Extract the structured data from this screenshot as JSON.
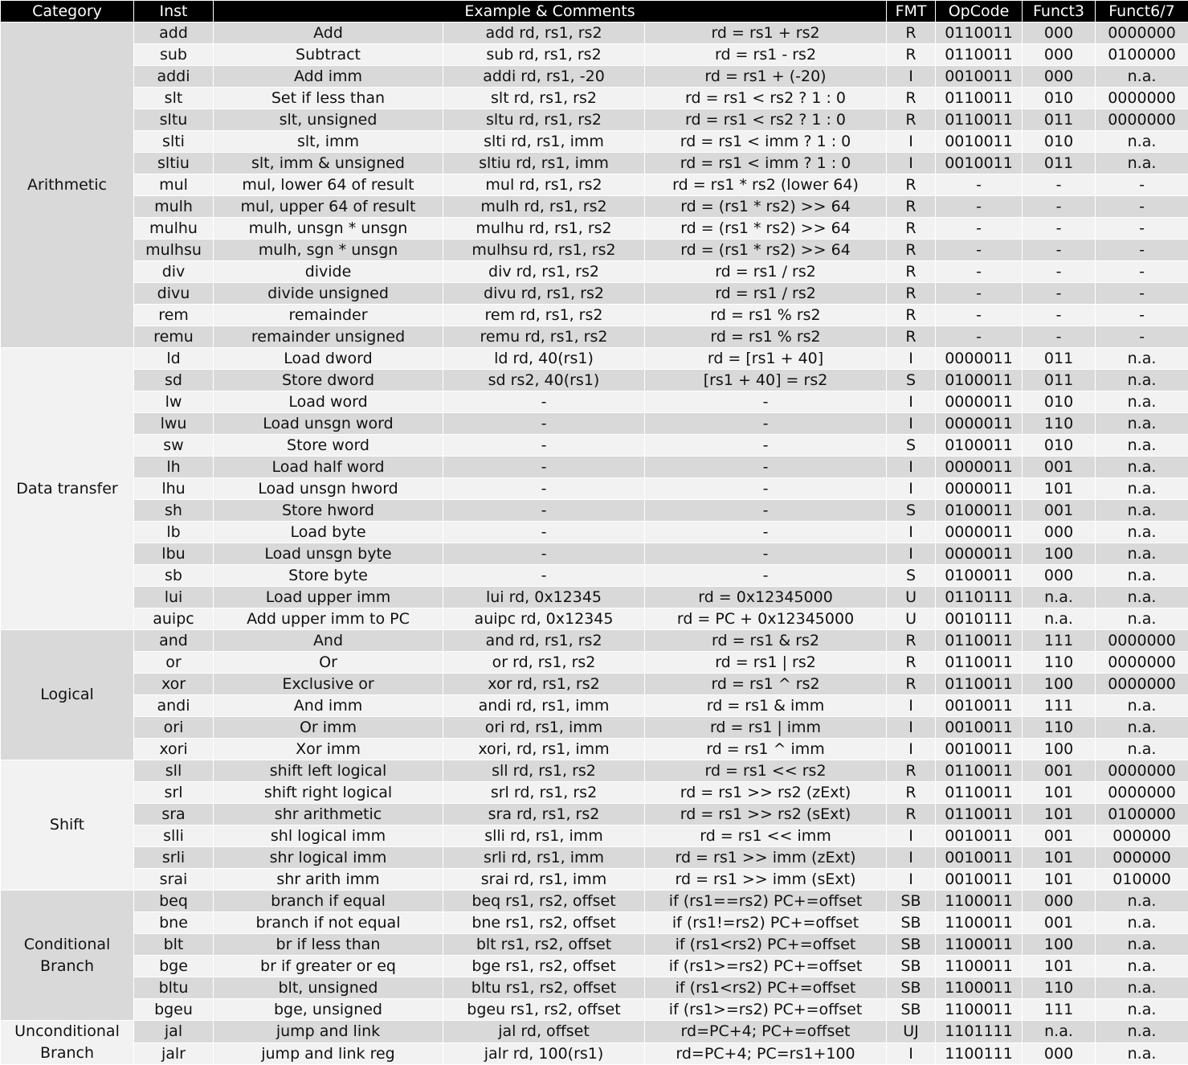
{
  "headers": {
    "category": "Category",
    "inst": "Inst",
    "example": "Example & Comments",
    "fmt": "FMT",
    "opcode": "OpCode",
    "funct3": "Funct3",
    "funct67": "Funct6/7"
  },
  "colors": {
    "header_bg": "#000000",
    "header_fg": "#ffffff",
    "shade_dark": "#d9d9d9",
    "shade_light": "#f2f2f2"
  },
  "groups": [
    {
      "category": "Arithmetic",
      "rows": [
        {
          "inst": "add",
          "desc": "Add",
          "example": "add rd, rs1, rs2",
          "comment": "rd = rs1 + rs2",
          "fmt": "R",
          "opcode": "0110011",
          "funct3": "000",
          "funct67": "0000000"
        },
        {
          "inst": "sub",
          "desc": "Subtract",
          "example": "sub rd, rs1, rs2",
          "comment": "rd = rs1 - rs2",
          "fmt": "R",
          "opcode": "0110011",
          "funct3": "000",
          "funct67": "0100000"
        },
        {
          "inst": "addi",
          "desc": "Add imm",
          "example": "addi rd, rs1, -20",
          "comment": "rd = rs1 + (-20)",
          "fmt": "I",
          "opcode": "0010011",
          "funct3": "000",
          "funct67": "n.a."
        },
        {
          "inst": "slt",
          "desc": "Set if less than",
          "example": "slt rd, rs1, rs2",
          "comment": "rd = rs1 < rs2 ? 1 : 0",
          "fmt": "R",
          "opcode": "0110011",
          "funct3": "010",
          "funct67": "0000000"
        },
        {
          "inst": "sltu",
          "desc": "slt, unsigned",
          "example": "sltu rd, rs1, rs2",
          "comment": "rd = rs1 < rs2 ? 1 : 0",
          "fmt": "R",
          "opcode": "0110011",
          "funct3": "011",
          "funct67": "0000000"
        },
        {
          "inst": "slti",
          "desc": "slt, imm",
          "example": "slti rd, rs1, imm",
          "comment": "rd = rs1 < imm ? 1 : 0",
          "fmt": "I",
          "opcode": "0010011",
          "funct3": "010",
          "funct67": "n.a."
        },
        {
          "inst": "sltiu",
          "desc": "slt, imm & unsigned",
          "example": "sltiu rd, rs1, imm",
          "comment": "rd = rs1 < imm ? 1 : 0",
          "fmt": "I",
          "opcode": "0010011",
          "funct3": "011",
          "funct67": "n.a."
        },
        {
          "inst": "mul",
          "desc": "mul, lower 64 of result",
          "example": "mul rd, rs1, rs2",
          "comment": "rd = rs1 * rs2 (lower 64)",
          "fmt": "R",
          "opcode": "-",
          "funct3": "-",
          "funct67": "-"
        },
        {
          "inst": "mulh",
          "desc": "mul, upper 64 of result",
          "example": "mulh rd, rs1, rs2",
          "comment": "rd = (rs1 * rs2) >> 64",
          "fmt": "R",
          "opcode": "-",
          "funct3": "-",
          "funct67": "-"
        },
        {
          "inst": "mulhu",
          "desc": "mulh, unsgn * unsgn",
          "example": "mulhu rd, rs1, rs2",
          "comment": "rd = (rs1 * rs2) >> 64",
          "fmt": "R",
          "opcode": "-",
          "funct3": "-",
          "funct67": "-"
        },
        {
          "inst": "mulhsu",
          "desc": "mulh, sgn * unsgn",
          "example": "mulhsu rd, rs1, rs2",
          "comment": "rd = (rs1 * rs2) >> 64",
          "fmt": "R",
          "opcode": "-",
          "funct3": "-",
          "funct67": "-"
        },
        {
          "inst": "div",
          "desc": "divide",
          "example": "div rd, rs1, rs2",
          "comment": "rd = rs1 / rs2",
          "fmt": "R",
          "opcode": "-",
          "funct3": "-",
          "funct67": "-"
        },
        {
          "inst": "divu",
          "desc": "divide unsigned",
          "example": "divu rd, rs1, rs2",
          "comment": "rd = rs1 / rs2",
          "fmt": "R",
          "opcode": "-",
          "funct3": "-",
          "funct67": "-"
        },
        {
          "inst": "rem",
          "desc": "remainder",
          "example": "rem rd, rs1, rs2",
          "comment": "rd = rs1 % rs2",
          "fmt": "R",
          "opcode": "-",
          "funct3": "-",
          "funct67": "-"
        },
        {
          "inst": "remu",
          "desc": "remainder unsigned",
          "example": "remu rd, rs1, rs2",
          "comment": "rd = rs1 % rs2",
          "fmt": "R",
          "opcode": "-",
          "funct3": "-",
          "funct67": "-"
        }
      ]
    },
    {
      "category": "Data transfer",
      "rows": [
        {
          "inst": "ld",
          "desc": "Load dword",
          "example": "ld rd, 40(rs1)",
          "comment": "rd = [rs1 + 40]",
          "fmt": "I",
          "opcode": "0000011",
          "funct3": "011",
          "funct67": "n.a."
        },
        {
          "inst": "sd",
          "desc": "Store dword",
          "example": "sd rs2, 40(rs1)",
          "comment": "[rs1 + 40] = rs2",
          "fmt": "S",
          "opcode": "0100011",
          "funct3": "011",
          "funct67": "n.a."
        },
        {
          "inst": "lw",
          "desc": "Load word",
          "example": "-",
          "comment": "-",
          "fmt": "I",
          "opcode": "0000011",
          "funct3": "010",
          "funct67": "n.a."
        },
        {
          "inst": "lwu",
          "desc": "Load unsgn word",
          "example": "-",
          "comment": "-",
          "fmt": "I",
          "opcode": "0000011",
          "funct3": "110",
          "funct67": "n.a."
        },
        {
          "inst": "sw",
          "desc": "Store word",
          "example": "-",
          "comment": "-",
          "fmt": "S",
          "opcode": "0100011",
          "funct3": "010",
          "funct67": "n.a."
        },
        {
          "inst": "lh",
          "desc": "Load half word",
          "example": "-",
          "comment": "-",
          "fmt": "I",
          "opcode": "0000011",
          "funct3": "001",
          "funct67": "n.a."
        },
        {
          "inst": "lhu",
          "desc": "Load unsgn hword",
          "example": "-",
          "comment": "-",
          "fmt": "I",
          "opcode": "0000011",
          "funct3": "101",
          "funct67": "n.a."
        },
        {
          "inst": "sh",
          "desc": "Store hword",
          "example": "-",
          "comment": "-",
          "fmt": "S",
          "opcode": "0100011",
          "funct3": "001",
          "funct67": "n.a."
        },
        {
          "inst": "lb",
          "desc": "Load byte",
          "example": "-",
          "comment": "-",
          "fmt": "I",
          "opcode": "0000011",
          "funct3": "000",
          "funct67": "n.a."
        },
        {
          "inst": "lbu",
          "desc": "Load unsgn byte",
          "example": "-",
          "comment": "-",
          "fmt": "I",
          "opcode": "0000011",
          "funct3": "100",
          "funct67": "n.a."
        },
        {
          "inst": "sb",
          "desc": "Store byte",
          "example": "-",
          "comment": "-",
          "fmt": "S",
          "opcode": "0100011",
          "funct3": "000",
          "funct67": "n.a."
        },
        {
          "inst": "lui",
          "desc": "Load upper imm",
          "example": "lui rd, 0x12345",
          "comment": "rd = 0x12345000",
          "fmt": "U",
          "opcode": "0110111",
          "funct3": "n.a.",
          "funct67": "n.a."
        },
        {
          "inst": "auipc",
          "desc": "Add upper imm to PC",
          "example": "auipc rd, 0x12345",
          "comment": "rd = PC + 0x12345000",
          "fmt": "U",
          "opcode": "0010111",
          "funct3": "n.a.",
          "funct67": "n.a."
        }
      ]
    },
    {
      "category": "Logical",
      "rows": [
        {
          "inst": "and",
          "desc": "And",
          "example": "and rd, rs1, rs2",
          "comment": "rd = rs1 & rs2",
          "fmt": "R",
          "opcode": "0110011",
          "funct3": "111",
          "funct67": "0000000"
        },
        {
          "inst": "or",
          "desc": "Or",
          "example": "or rd, rs1, rs2",
          "comment": "rd = rs1 | rs2",
          "fmt": "R",
          "opcode": "0110011",
          "funct3": "110",
          "funct67": "0000000"
        },
        {
          "inst": "xor",
          "desc": "Exclusive or",
          "example": "xor rd, rs1, rs2",
          "comment": "rd = rs1 ^ rs2",
          "fmt": "R",
          "opcode": "0110011",
          "funct3": "100",
          "funct67": "0000000"
        },
        {
          "inst": "andi",
          "desc": "And imm",
          "example": "andi rd, rs1, imm",
          "comment": "rd = rs1 & imm",
          "fmt": "I",
          "opcode": "0010011",
          "funct3": "111",
          "funct67": "n.a."
        },
        {
          "inst": "ori",
          "desc": "Or imm",
          "example": "ori rd, rs1, imm",
          "comment": "rd = rs1 | imm",
          "fmt": "I",
          "opcode": "0010011",
          "funct3": "110",
          "funct67": "n.a."
        },
        {
          "inst": "xori",
          "desc": "Xor imm",
          "example": "xori, rd, rs1, imm",
          "comment": "rd = rs1 ^ imm",
          "fmt": "I",
          "opcode": "0010011",
          "funct3": "100",
          "funct67": "n.a."
        }
      ]
    },
    {
      "category": "Shift",
      "rows": [
        {
          "inst": "sll",
          "desc": "shift left logical",
          "example": "sll rd, rs1, rs2",
          "comment": "rd = rs1 << rs2",
          "fmt": "R",
          "opcode": "0110011",
          "funct3": "001",
          "funct67": "0000000"
        },
        {
          "inst": "srl",
          "desc": "shift right logical",
          "example": "srl rd, rs1, rs2",
          "comment": "rd = rs1 >> rs2 (zExt)",
          "fmt": "R",
          "opcode": "0110011",
          "funct3": "101",
          "funct67": "0000000"
        },
        {
          "inst": "sra",
          "desc": "shr arithmetic",
          "example": "sra rd, rs1, rs2",
          "comment": "rd = rs1 >> rs2 (sExt)",
          "fmt": "R",
          "opcode": "0110011",
          "funct3": "101",
          "funct67": "0100000"
        },
        {
          "inst": "slli",
          "desc": "shl logical imm",
          "example": "slli rd, rs1, imm",
          "comment": "rd = rs1 << imm",
          "fmt": "I",
          "opcode": "0010011",
          "funct3": "001",
          "funct67": "000000"
        },
        {
          "inst": "srli",
          "desc": "shr logical imm",
          "example": "srli rd, rs1, imm",
          "comment": "rd = rs1 >> imm (zExt)",
          "fmt": "I",
          "opcode": "0010011",
          "funct3": "101",
          "funct67": "000000"
        },
        {
          "inst": "srai",
          "desc": "shr arith imm",
          "example": "srai rd, rs1, imm",
          "comment": "rd = rs1 >> imm (sExt)",
          "fmt": "I",
          "opcode": "0010011",
          "funct3": "101",
          "funct67": "010000"
        }
      ]
    },
    {
      "category": "Conditional Branch",
      "rows": [
        {
          "inst": "beq",
          "desc": "branch if equal",
          "example": "beq rs1, rs2, offset",
          "comment": "if (rs1==rs2) PC+=offset",
          "fmt": "SB",
          "opcode": "1100011",
          "funct3": "000",
          "funct67": "n.a."
        },
        {
          "inst": "bne",
          "desc": "branch if not equal",
          "example": "bne rs1, rs2, offset",
          "comment": "if (rs1!=rs2) PC+=offset",
          "fmt": "SB",
          "opcode": "1100011",
          "funct3": "001",
          "funct67": "n.a."
        },
        {
          "inst": "blt",
          "desc": "br if less than",
          "example": "blt rs1, rs2, offset",
          "comment": "if (rs1<rs2) PC+=offset",
          "fmt": "SB",
          "opcode": "1100011",
          "funct3": "100",
          "funct67": "n.a."
        },
        {
          "inst": "bge",
          "desc": "br if greater or eq",
          "example": "bge rs1, rs2, offset",
          "comment": "if (rs1>=rs2) PC+=offset",
          "fmt": "SB",
          "opcode": "1100011",
          "funct3": "101",
          "funct67": "n.a."
        },
        {
          "inst": "bltu",
          "desc": "blt, unsigned",
          "example": "bltu rs1, rs2, offset",
          "comment": "if (rs1<rs2) PC+=offset",
          "fmt": "SB",
          "opcode": "1100011",
          "funct3": "110",
          "funct67": "n.a."
        },
        {
          "inst": "bgeu",
          "desc": "bge, unsigned",
          "example": "bgeu rs1, rs2, offset",
          "comment": "if (rs1>=rs2) PC+=offset",
          "fmt": "SB",
          "opcode": "1100011",
          "funct3": "111",
          "funct67": "n.a."
        }
      ]
    },
    {
      "category": "Unconditional Branch",
      "rows": [
        {
          "inst": "jal",
          "desc": "jump and link",
          "example": "jal rd, offset",
          "comment": "rd=PC+4; PC+=offset",
          "fmt": "UJ",
          "opcode": "1101111",
          "funct3": "n.a.",
          "funct67": "n.a."
        },
        {
          "inst": "jalr",
          "desc": "jump and link reg",
          "example": "jalr rd, 100(rs1)",
          "comment": "rd=PC+4; PC=rs1+100",
          "fmt": "I",
          "opcode": "1100111",
          "funct3": "000",
          "funct67": "n.a."
        }
      ]
    }
  ]
}
